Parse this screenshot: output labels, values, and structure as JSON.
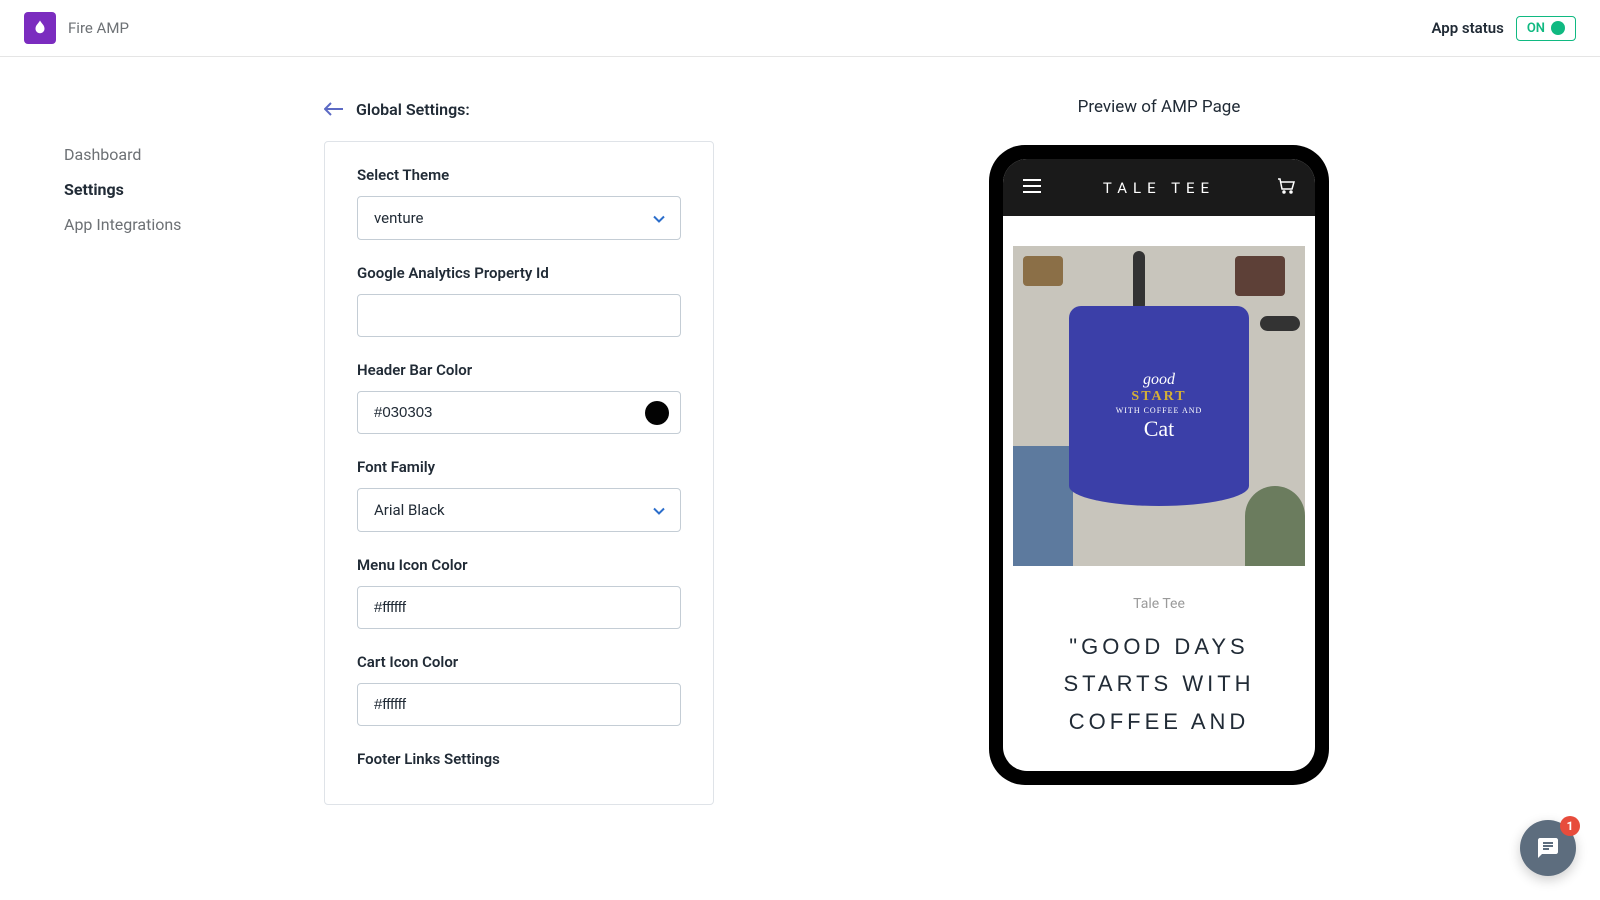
{
  "header": {
    "app_name": "Fire AMP",
    "status_label": "App status",
    "status_value": "ON"
  },
  "sidebar": {
    "items": [
      {
        "label": "Dashboard"
      },
      {
        "label": "Settings"
      },
      {
        "label": "App Integrations"
      }
    ]
  },
  "breadcrumb": {
    "title": "Global Settings:"
  },
  "form": {
    "select_theme_label": "Select Theme",
    "select_theme_value": "venture",
    "ga_label": "Google Analytics Property Id",
    "ga_value": "",
    "header_bar_color_label": "Header Bar Color",
    "header_bar_color_value": "#030303",
    "font_family_label": "Font Family",
    "font_family_value": "Arial Black",
    "menu_icon_color_label": "Menu Icon Color",
    "menu_icon_color_value": "#ffffff",
    "cart_icon_color_label": "Cart Icon Color",
    "cart_icon_color_value": "#ffffff",
    "footer_links_label": "Footer Links Settings"
  },
  "preview": {
    "title": "Preview of AMP Page",
    "brand": "TALE TEE",
    "product_brand": "Tale Tee",
    "product_title": "\"GOOD DAYS STARTS WITH COFFEE AND",
    "tshirt": {
      "line1": "good",
      "line2": "START",
      "line3": "WITH COFFEE AND",
      "line4": "Cat"
    }
  },
  "chat": {
    "badge_count": "1"
  }
}
